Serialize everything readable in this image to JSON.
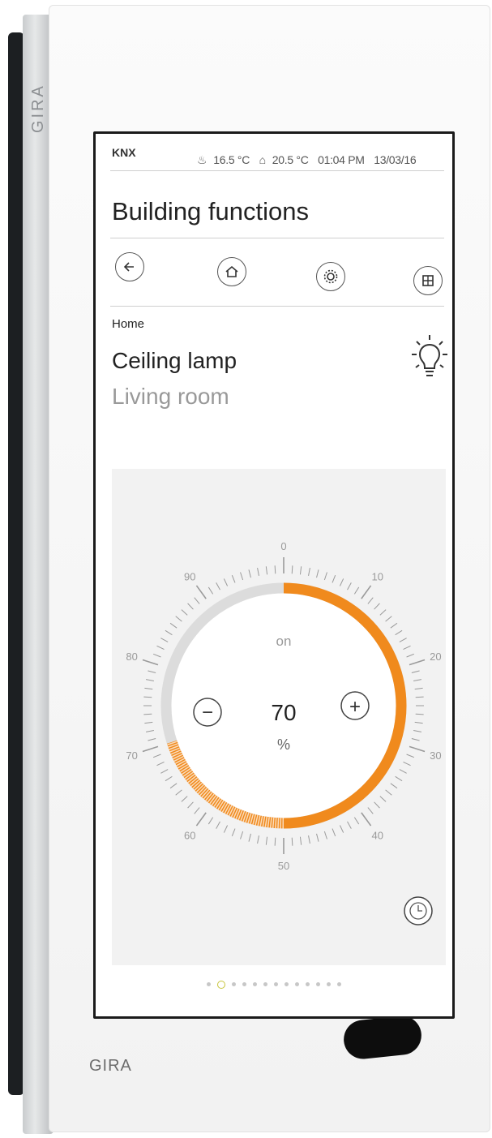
{
  "brand": {
    "side": "GIRA",
    "bottom": "GIRA"
  },
  "status_bar": {
    "system": "KNX",
    "outdoor_temp": "16.5 °C",
    "indoor_temp": "20.5 °C",
    "time": "01:04 PM",
    "date": "13/03/16"
  },
  "page_title": "Building functions",
  "nav": {
    "icons": [
      "back-arrow-icon",
      "home-icon",
      "settings-gear-icon",
      "grid-icon"
    ]
  },
  "item": {
    "breadcrumb": "Home",
    "name": "Ceiling lamp",
    "room": "Living room",
    "icon": "light-bulb-icon"
  },
  "dimmer": {
    "state": "on",
    "value": "70",
    "unit": "%",
    "level_percent": 70,
    "scale_labels": [
      "0",
      "10",
      "20",
      "30",
      "40",
      "50",
      "60",
      "70",
      "80",
      "90"
    ],
    "minus_label": "−",
    "plus_label": "+",
    "timer_icon": "clock-icon",
    "accent_color": "#f08a1d",
    "track_color": "#dcdcdc"
  },
  "pager": {
    "count": 13,
    "active_index": 1
  }
}
